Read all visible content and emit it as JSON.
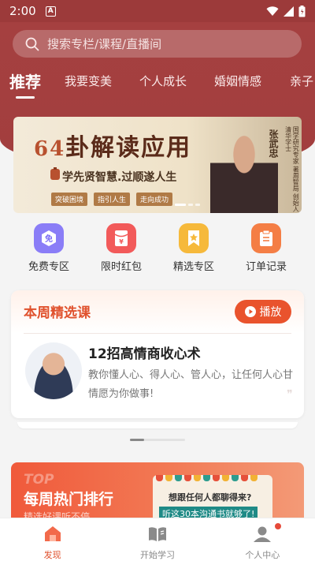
{
  "status": {
    "time": "2:00",
    "notif_letter": "A"
  },
  "search": {
    "placeholder": "搜索专栏/课程/直播间"
  },
  "tabs": [
    {
      "label": "推荐"
    },
    {
      "label": "我要变美"
    },
    {
      "label": "个人成长"
    },
    {
      "label": "婚姻情感"
    },
    {
      "label": "亲子"
    }
  ],
  "banner": {
    "title_num": "64",
    "title_text": "卦解读应用",
    "subtitle": "学先贤智慧.过顺遂人生",
    "chips": [
      "突破困境",
      "指引人生",
      "走向成功"
    ],
    "name": "张武忠",
    "desc": "国学研究专家 著周智局 创始人 清华学士"
  },
  "quick": [
    {
      "label": "免费专区",
      "icon": "free-icon",
      "color": "#7b6cf6"
    },
    {
      "label": "限时红包",
      "icon": "red-packet-icon",
      "color": "#f25a5a"
    },
    {
      "label": "精选专区",
      "icon": "star-bookmark-icon",
      "color": "#f6b93b"
    },
    {
      "label": "订单记录",
      "icon": "clipboard-icon",
      "color": "#f47e45"
    }
  ],
  "weekly": {
    "title": "本周精选课",
    "play_label": "播放",
    "course_title": "12招高情商收心术",
    "course_desc": "教你懂人心、得人心、管人心，让任何人心甘情愿为你做事!"
  },
  "rank": {
    "top_word": "TOP",
    "title": "每周热门排行",
    "subtitle": "精选好课听不停",
    "book_q": "想跟任何人都聊得来?",
    "book_hl": "听这30本沟通书就够了!"
  },
  "tabbar": [
    {
      "label": "发现",
      "icon": "discover-icon",
      "active": true
    },
    {
      "label": "开始学习",
      "icon": "book-icon",
      "active": false
    },
    {
      "label": "个人中心",
      "icon": "profile-icon",
      "active": false
    }
  ],
  "colors": {
    "brand": "#a54040",
    "accent": "#e9532d"
  }
}
